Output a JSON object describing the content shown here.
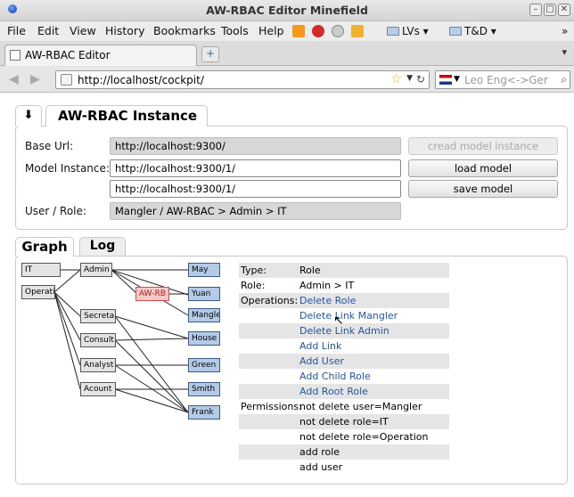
{
  "window": {
    "title": "AW-RBAC Editor   Minefield"
  },
  "menu": [
    "File",
    "Edit",
    "View",
    "History",
    "Bookmarks",
    "Tools",
    "Help"
  ],
  "bookmarks": [
    "LVs",
    "T&D"
  ],
  "tab": {
    "label": "AW-RBAC Editor"
  },
  "nav": {
    "url": "http://localhost/cockpit/",
    "search_placeholder": "Leo Eng<->Ger"
  },
  "instance": {
    "tab_label": "AW-RBAC Instance",
    "base_url_label": "Base Url:",
    "base_url": "http://localhost:9300/",
    "model_instance_label": "Model Instance:",
    "model_instance": "http://localhost:9300/1/",
    "save_target": "http://localhost:9300/1/",
    "user_role_label": "User / Role:",
    "user_role": "Mangler / AW-RBAC > Admin > IT",
    "create_button": "cread model instance",
    "load_button": "load model",
    "save_button": "save model"
  },
  "tabs": {
    "graph": "Graph",
    "log": "Log"
  },
  "graph": {
    "roots": [
      "IT",
      "Operati"
    ],
    "roles": [
      "Admin",
      "Secreta",
      "Consult",
      "Analyst",
      "Acount"
    ],
    "highlight": "AW-RB",
    "users": [
      "May",
      "Yuan",
      "Mangle",
      "House",
      "Green",
      "Smith",
      "Frank"
    ]
  },
  "details": {
    "type_label": "Type:",
    "type_value": "Role",
    "role_label": "Role:",
    "role_value": "Admin > IT",
    "operations_label": "Operations:",
    "operations": [
      "Delete Role",
      "Delete Link Mangler",
      "Delete Link Admin",
      "Add Link",
      "Add User",
      "Add Child Role",
      "Add Root Role"
    ],
    "permissions_label": "Permissions:",
    "permissions": [
      "not delete user=Mangler",
      "not delete role=IT",
      "not delete role=Operation",
      "add role",
      "add user"
    ]
  }
}
